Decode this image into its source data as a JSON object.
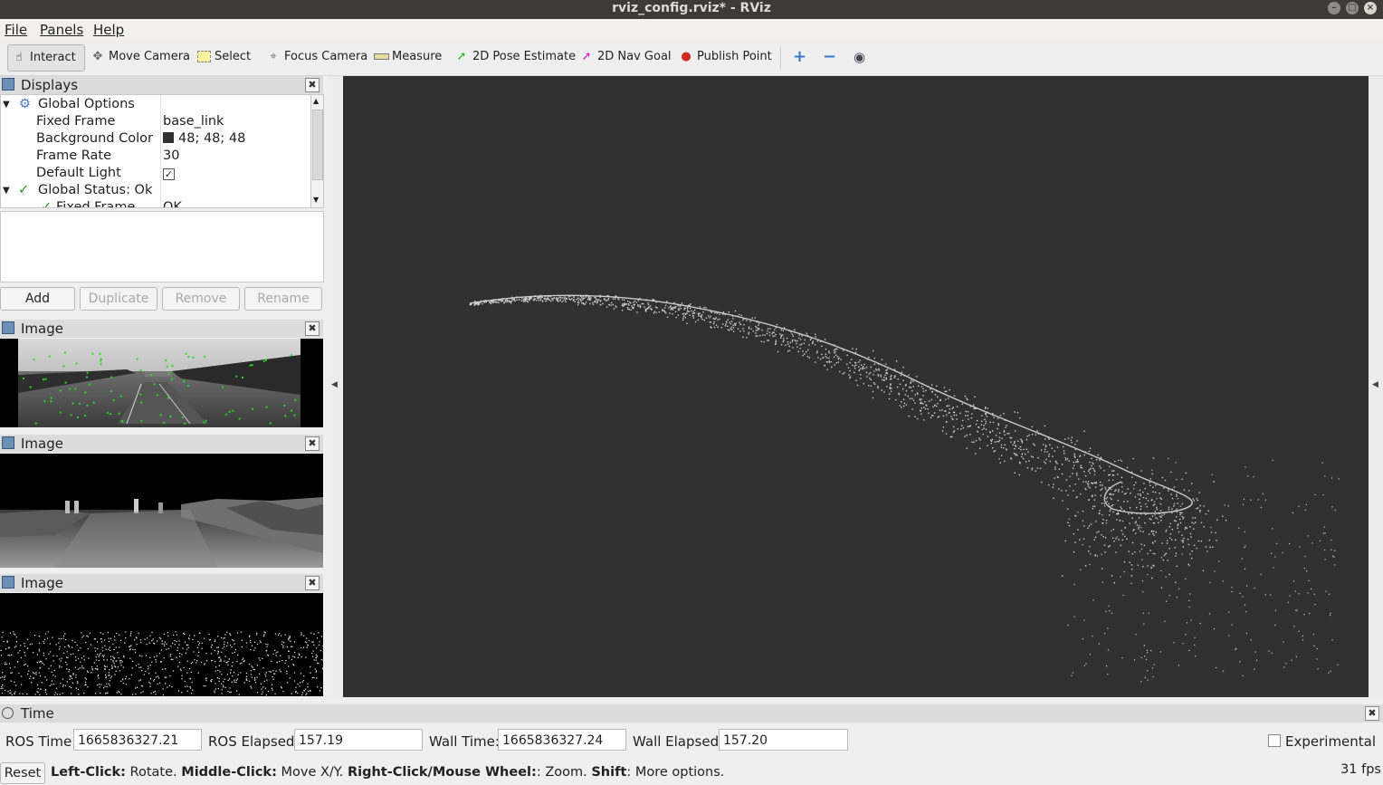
{
  "window": {
    "title": "rviz_config.rviz* - RViz"
  },
  "menu": [
    "File",
    "Panels",
    "Help"
  ],
  "toolbar": {
    "tools": [
      "Interact",
      "Move Camera",
      "Select",
      "Focus Camera",
      "Measure",
      "2D Pose Estimate",
      "2D Nav Goal",
      "Publish Point"
    ],
    "active": "Interact",
    "icons": [
      "hand-cursor-icon",
      "move-camera-icon",
      "select-box-icon",
      "focus-camera-icon",
      "ruler-icon",
      "green-arrow-icon",
      "magenta-arrow-icon",
      "map-pin-icon",
      "plus-icon",
      "minus-icon",
      "eye-icon"
    ]
  },
  "displays": {
    "title": "Displays",
    "rows": [
      {
        "key": "Global Options",
        "value": ""
      },
      {
        "key": "Fixed Frame",
        "value": "base_link"
      },
      {
        "key": "Background Color",
        "value": "48; 48; 48"
      },
      {
        "key": "Frame Rate",
        "value": "30"
      },
      {
        "key": "Default Light",
        "value": ""
      },
      {
        "key": "Global Status: Ok",
        "value": ""
      },
      {
        "key": "Fixed Frame",
        "value": "OK"
      }
    ],
    "default_light_checked": true,
    "background_color": "#303030",
    "buttons": {
      "add": "Add",
      "duplicate": "Duplicate",
      "remove": "Remove",
      "rename": "Rename"
    }
  },
  "image_panels": [
    "Image",
    "Image",
    "Image"
  ],
  "time": {
    "title": "Time",
    "ros_time_label": "ROS Time:",
    "ros_time": "1665836327.21",
    "ros_elapsed_label": "ROS Elapsed:",
    "ros_elapsed": "157.19",
    "wall_time_label": "Wall Time:",
    "wall_time": "1665836327.24",
    "wall_elapsed_label": "Wall Elapsed:",
    "wall_elapsed": "157.20",
    "experimental_label": "Experimental",
    "experimental_checked": false
  },
  "status": {
    "reset": "Reset",
    "hint_left_b": "Left-Click:",
    "hint_left": " Rotate. ",
    "hint_mid_b": "Middle-Click:",
    "hint_mid": " Move X/Y. ",
    "hint_right_b": "Right-Click/Mouse Wheel:",
    "hint_right": ": Zoom. ",
    "hint_shift_b": "Shift",
    "hint_shift": ": More options.",
    "fps": "31 fps"
  },
  "colors": {
    "render_bg": "#303030",
    "feature_points": "#22dd22",
    "title_bar": "#3c3b37"
  }
}
